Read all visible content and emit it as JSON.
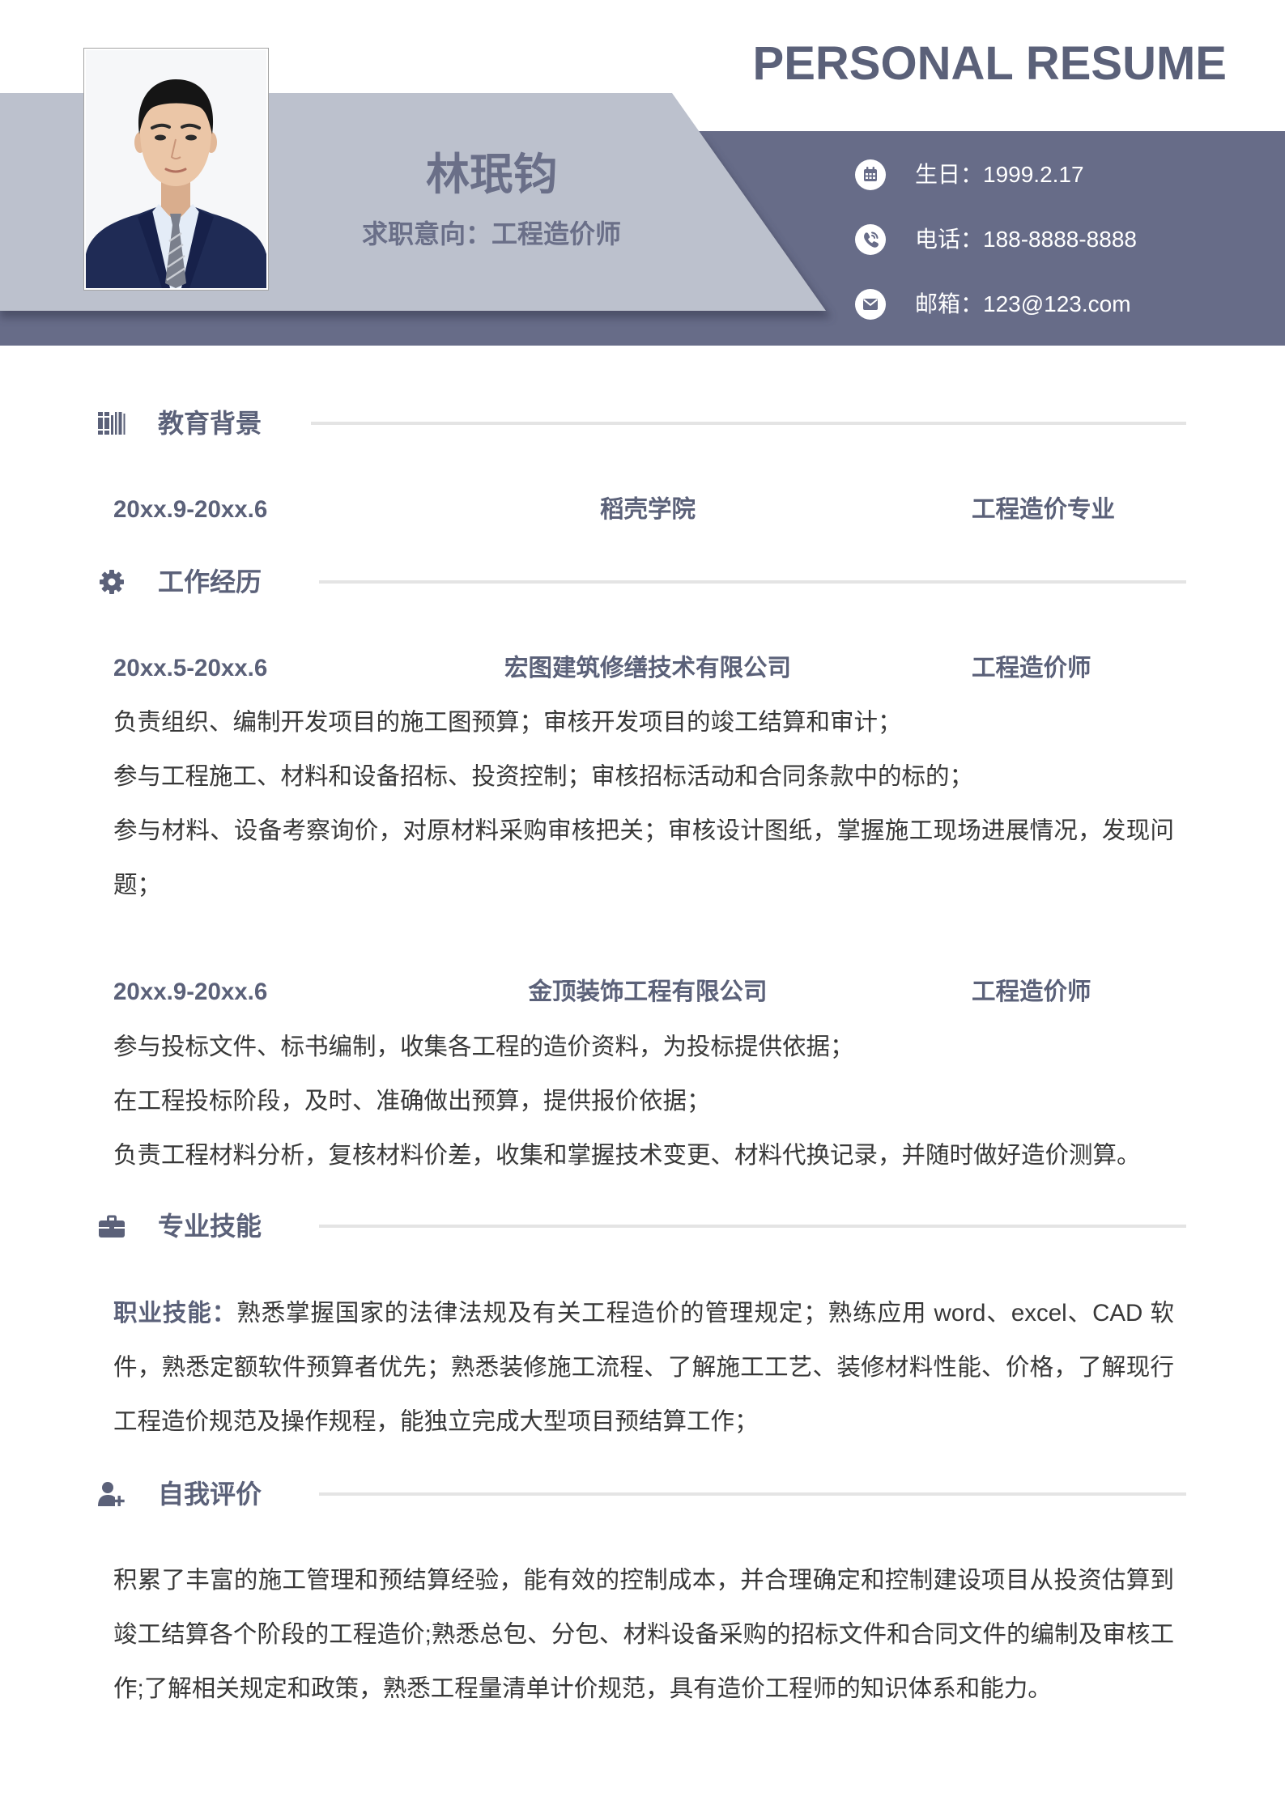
{
  "colors": {
    "header_dark": "#676c88",
    "header_light": "#bcc1cd",
    "heading": "#5b6179",
    "name": "#6a6f88",
    "body_text": "#383838",
    "divider": "#e4e4e4"
  },
  "header": {
    "title": "PERSONAL RESUME",
    "name": "林珉钧",
    "objective": "求职意向：工程造价师",
    "contacts": [
      {
        "icon": "calendar-icon",
        "label": "生日：",
        "value": "1999.2.17"
      },
      {
        "icon": "phone-icon",
        "label": "电话：",
        "value": "188-8888-8888"
      },
      {
        "icon": "email-icon",
        "label": "邮箱：",
        "value": "123@123.com"
      }
    ]
  },
  "education": {
    "icon": "books-icon",
    "title": "教育背景",
    "entries": [
      {
        "period": "20xx.9-20xx.6",
        "school": "稻壳学院",
        "major": "工程造价专业"
      }
    ]
  },
  "work": {
    "icon": "gear-icon",
    "title": "工作经历",
    "entries": [
      {
        "period": "20xx.5-20xx.6",
        "company": "宏图建筑修缮技术有限公司",
        "position": "工程造价师",
        "duties": [
          "负责组织、编制开发项目的施工图预算；审核开发项目的竣工结算和审计；",
          "参与工程施工、材料和设备招标、投资控制；审核招标活动和合同条款中的标的；",
          "参与材料、设备考察询价，对原材料采购审核把关；审核设计图纸，掌握施工现场进展情况，发现问题；"
        ]
      },
      {
        "period": "20xx.9-20xx.6",
        "company": "金顶装饰工程有限公司",
        "position": "工程造价师",
        "duties": [
          "参与投标文件、标书编制，收集各工程的造价资料，为投标提供依据；",
          "在工程投标阶段，及时、准确做出预算，提供报价依据；",
          "负责工程材料分析，复核材料价差，收集和掌握技术变更、材料代换记录，并随时做好造价测算。"
        ]
      }
    ]
  },
  "skills": {
    "icon": "briefcase-icon",
    "title": "专业技能",
    "label": "职业技能：",
    "text": "熟悉掌握国家的法律法规及有关工程造价的管理规定；熟练应用 word、excel、CAD 软件，熟悉定额软件预算者优先；熟悉装修施工流程、了解施工工艺、装修材料性能、价格，了解现行工程造价规范及操作规程，能独立完成大型项目预结算工作；"
  },
  "self_evaluation": {
    "icon": "user-plus-icon",
    "title": "自我评价",
    "text": "积累了丰富的施工管理和预结算经验，能有效的控制成本，并合理确定和控制建设项目从投资估算到竣工结算各个阶段的工程造价;熟悉总包、分包、材料设备采购的招标文件和合同文件的编制及审核工作;了解相关规定和政策，熟悉工程量清单计价规范，具有造价工程师的知识体系和能力。"
  }
}
